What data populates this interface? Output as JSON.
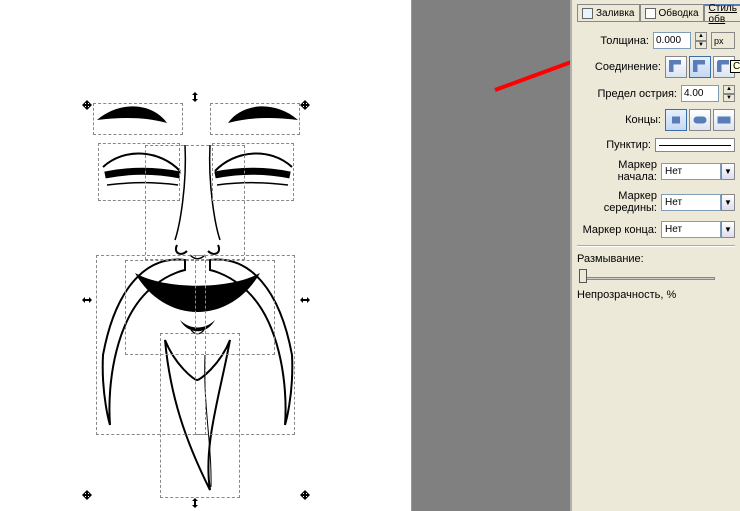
{
  "tabs": {
    "fill": "Заливка",
    "stroke": "Обводка",
    "style": "Стиль обв"
  },
  "labels": {
    "width": "Толщина:",
    "join": "Соединение:",
    "miter": "Предел острия:",
    "caps": "Концы:",
    "dash": "Пунктир:",
    "marker_start": "Маркер начала:",
    "marker_mid": "Маркер середины:",
    "marker_end": "Маркер конца:",
    "blur": "Размывание:",
    "opacity": "Непрозрачность, %"
  },
  "values": {
    "width": "0.000",
    "miter": "4.00",
    "unit": "px",
    "join_tooltip": "Скругл",
    "marker_start": "Нет",
    "marker_mid": "Нет",
    "marker_end": "Нет"
  }
}
